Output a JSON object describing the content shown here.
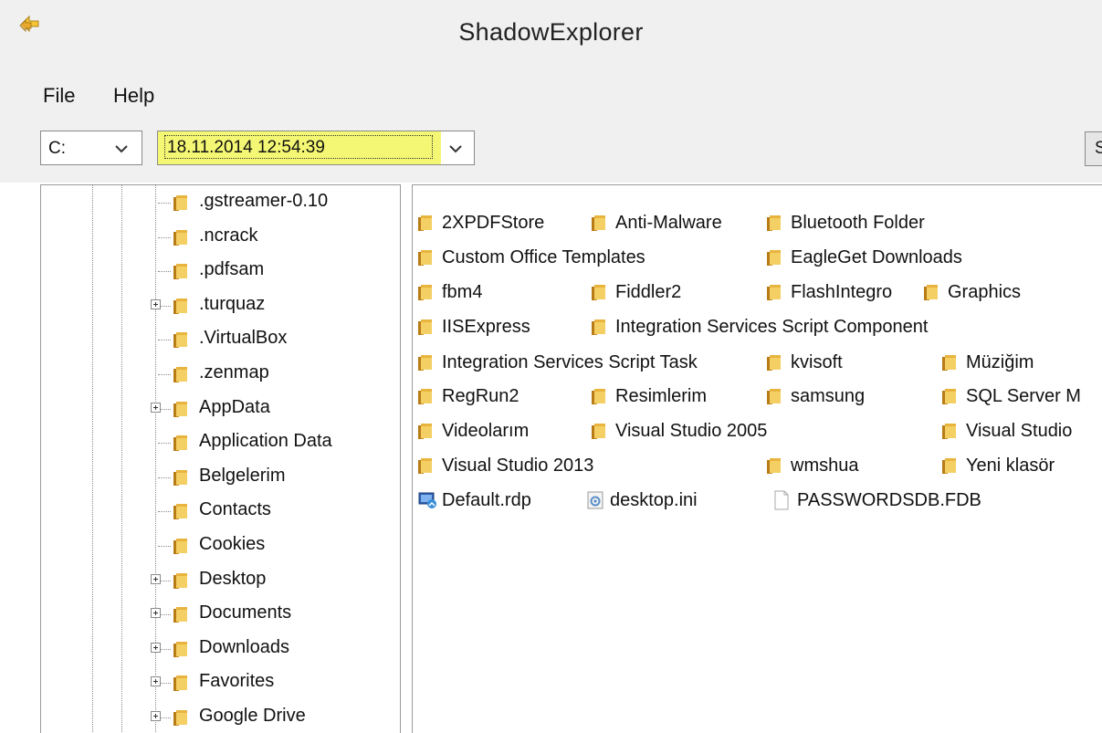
{
  "window": {
    "title": "ShadowExplorer"
  },
  "menu": {
    "file": "File",
    "help": "Help"
  },
  "toolbar": {
    "drive": "C:",
    "snapshot": "18.11.2014 12:54:39",
    "refresh_partial": "S"
  },
  "tree": {
    "items": [
      {
        "label": ".gstreamer-0.10",
        "expandable": false
      },
      {
        "label": ".ncrack",
        "expandable": false
      },
      {
        "label": ".pdfsam",
        "expandable": false
      },
      {
        "label": ".turquaz",
        "expandable": true
      },
      {
        "label": ".VirtualBox",
        "expandable": false
      },
      {
        "label": ".zenmap",
        "expandable": false
      },
      {
        "label": "AppData",
        "expandable": true
      },
      {
        "label": "Application Data",
        "expandable": false
      },
      {
        "label": "Belgelerim",
        "expandable": false
      },
      {
        "label": "Contacts",
        "expandable": false
      },
      {
        "label": "Cookies",
        "expandable": false
      },
      {
        "label": "Desktop",
        "expandable": true
      },
      {
        "label": "Documents",
        "expandable": true
      },
      {
        "label": "Downloads",
        "expandable": true
      },
      {
        "label": "Favorites",
        "expandable": true
      },
      {
        "label": "Google Drive",
        "expandable": true
      }
    ]
  },
  "files": {
    "items": [
      {
        "label": "2XPDFStore",
        "type": "folder"
      },
      {
        "label": "Anti-Malware",
        "type": "folder"
      },
      {
        "label": "Bluetooth Folder",
        "type": "folder"
      },
      {
        "label": "Custom Office Templates",
        "type": "folder"
      },
      {
        "label": "EagleGet Downloads",
        "type": "folder"
      },
      {
        "label": "fbm4",
        "type": "folder"
      },
      {
        "label": "Fiddler2",
        "type": "folder"
      },
      {
        "label": "FlashIntegro",
        "type": "folder"
      },
      {
        "label": "Graphics",
        "type": "folder"
      },
      {
        "label": "IISExpress",
        "type": "folder"
      },
      {
        "label": "Integration Services Script Component",
        "type": "folder"
      },
      {
        "label": "Integration Services Script Task",
        "type": "folder"
      },
      {
        "label": "kvisoft",
        "type": "folder"
      },
      {
        "label": "Müziğim",
        "type": "folder"
      },
      {
        "label": "RegRun2",
        "type": "folder"
      },
      {
        "label": "Resimlerim",
        "type": "folder"
      },
      {
        "label": "samsung",
        "type": "folder"
      },
      {
        "label": "SQL Server M",
        "type": "folder"
      },
      {
        "label": "Videolarım",
        "type": "folder"
      },
      {
        "label": "Visual Studio 2005",
        "type": "folder"
      },
      {
        "label": "Visual Studio",
        "type": "folder"
      },
      {
        "label": "Visual Studio 2013",
        "type": "folder"
      },
      {
        "label": "wmshua",
        "type": "folder"
      },
      {
        "label": "Yeni klasör",
        "type": "folder"
      },
      {
        "label": "Default.rdp",
        "type": "rdp-file"
      },
      {
        "label": "desktop.ini",
        "type": "ini-file"
      },
      {
        "label": "PASSWORDSDB.FDB",
        "type": "generic-file"
      }
    ]
  },
  "colors": {
    "chrome": "#f0f0f0",
    "highlight": "#f4f773",
    "folder": "#e7b73e"
  }
}
